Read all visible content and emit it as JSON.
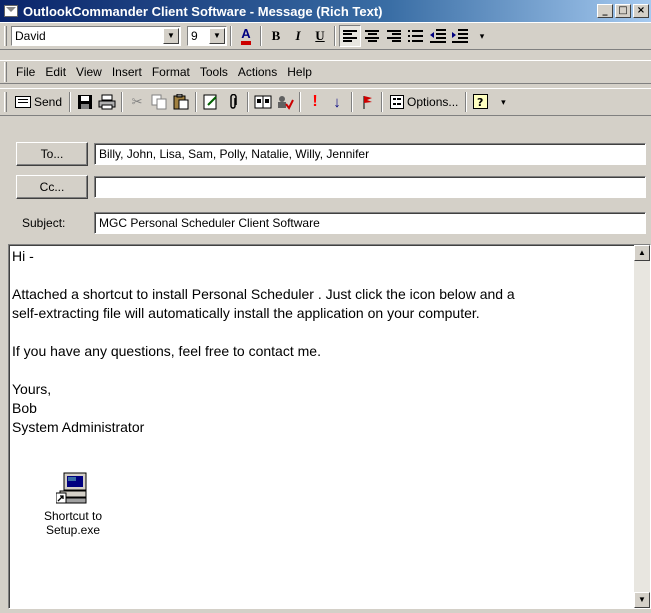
{
  "window": {
    "title": "OutlookCommander Client Software - Message (Rich Text)",
    "controls": [
      "minimize",
      "maximize",
      "close"
    ]
  },
  "format_toolbar": {
    "font_name": "David",
    "font_size": "9",
    "bold_label": "B",
    "italic_label": "I",
    "underline_label": "U",
    "font_color_label": "A"
  },
  "menu": {
    "items": [
      "File",
      "Edit",
      "View",
      "Insert",
      "Format",
      "Tools",
      "Actions",
      "Help"
    ]
  },
  "standard_toolbar": {
    "send_label": "Send",
    "options_label": "Options...",
    "importance_high_glyph": "!",
    "importance_low_glyph": "↓"
  },
  "header": {
    "to_label": "To...",
    "to_value": "Billy, John, Lisa, Sam, Polly, Natalie, Willy, Jennifer",
    "cc_label": "Cc...",
    "cc_value": "",
    "subject_label": "Subject:",
    "subject_value": "MGC Personal Scheduler Client Software"
  },
  "body": {
    "greeting": "Hi -",
    "paragraph1_line1": "Attached a shortcut to install Personal Scheduler . Just click the icon below and a",
    "paragraph1_line2": "self-extracting file will automatically install the application on your computer.",
    "paragraph2": "If you have any questions, feel free to contact me.",
    "closing": "Yours,",
    "signature_name": "Bob",
    "signature_title": "System Administrator"
  },
  "attachment": {
    "label_line1": "Shortcut to",
    "label_line2": "Setup.exe"
  },
  "colors": {
    "titlebar_start": "#0a246a",
    "titlebar_end": "#a6caf0",
    "chrome": "#d4d0c8",
    "importance_high": "#ff0000",
    "importance_low": "#000080"
  }
}
